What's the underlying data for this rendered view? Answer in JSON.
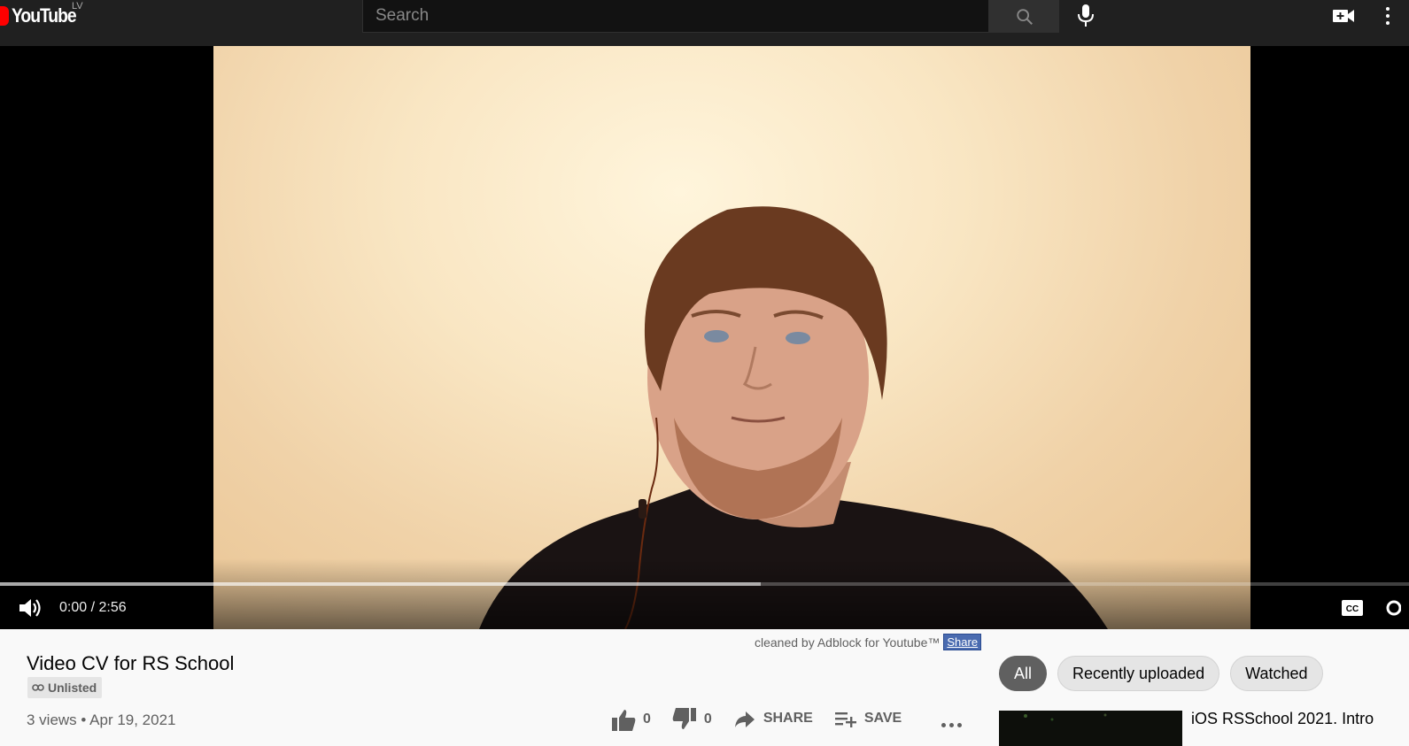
{
  "header": {
    "logo_text": "YouTube",
    "country_code": "LV",
    "search_placeholder": "Search",
    "search_icon": "search-icon",
    "mic_icon": "microphone-icon",
    "create_icon": "create-video-icon",
    "menu_icon": "more-vertical-icon"
  },
  "player": {
    "current_time": "0:00",
    "duration": "2:56",
    "time_display": "0:00 / 2:56",
    "buffered_fraction": 0.54,
    "played_fraction": 0.0,
    "volume_icon": "volume-icon",
    "captions_icon": "closed-captions-icon",
    "settings_icon": "settings-icon"
  },
  "adblock": {
    "note": "cleaned by Adblock for Youtube™",
    "share_label": "Share"
  },
  "video": {
    "title": "Video CV for RS School",
    "visibility": "Unlisted",
    "views": "3 views",
    "date": "Apr 19, 2021",
    "meta": "3 views • Apr 19, 2021"
  },
  "actions": {
    "like_count": "0",
    "dislike_count": "0",
    "share_label": "SHARE",
    "save_label": "SAVE"
  },
  "filters": {
    "chips": [
      "All",
      "Recently uploaded",
      "Watched"
    ],
    "active": "All"
  },
  "recommendations": [
    {
      "title": "iOS RSSchool 2021. Intro"
    }
  ],
  "colors": {
    "header_bg": "#202020",
    "logo_red": "#ff0000",
    "page_bg": "#f9f9f9",
    "chip_active": "#606060"
  }
}
